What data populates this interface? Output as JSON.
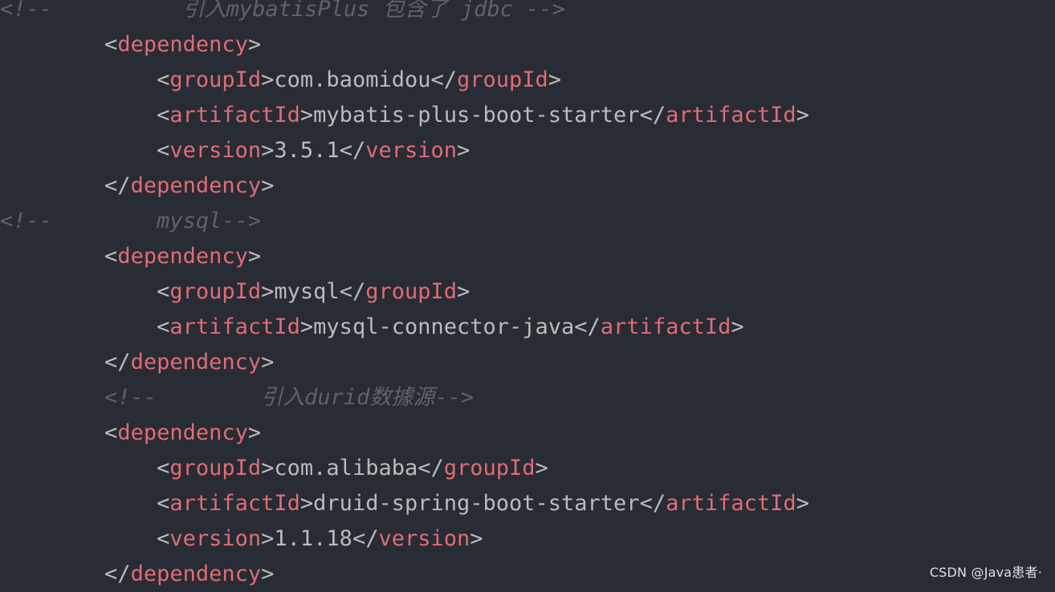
{
  "editor": {
    "lines": [
      {
        "kind": "comment",
        "indent": 0,
        "segments": [
          {
            "t": "<!--          引入mybatisPlus 包含了 jdbc -->",
            "c": "comment"
          }
        ]
      },
      {
        "kind": "tag",
        "indent": 8,
        "segments": [
          {
            "t": "<",
            "c": "punct"
          },
          {
            "t": "dependency",
            "c": "tag"
          },
          {
            "t": ">",
            "c": "punct"
          }
        ]
      },
      {
        "kind": "tag",
        "indent": 12,
        "segments": [
          {
            "t": "<",
            "c": "punct"
          },
          {
            "t": "groupId",
            "c": "tag"
          },
          {
            "t": ">",
            "c": "punct"
          },
          {
            "t": "com.baomidou",
            "c": "text"
          },
          {
            "t": "</",
            "c": "punct"
          },
          {
            "t": "groupId",
            "c": "tag"
          },
          {
            "t": ">",
            "c": "punct"
          }
        ]
      },
      {
        "kind": "tag",
        "indent": 12,
        "segments": [
          {
            "t": "<",
            "c": "punct"
          },
          {
            "t": "artifactId",
            "c": "tag"
          },
          {
            "t": ">",
            "c": "punct"
          },
          {
            "t": "mybatis-plus-boot-starter",
            "c": "text"
          },
          {
            "t": "</",
            "c": "punct"
          },
          {
            "t": "artifactId",
            "c": "tag"
          },
          {
            "t": ">",
            "c": "punct"
          }
        ]
      },
      {
        "kind": "tag",
        "indent": 12,
        "segments": [
          {
            "t": "<",
            "c": "punct"
          },
          {
            "t": "version",
            "c": "tag"
          },
          {
            "t": ">",
            "c": "punct"
          },
          {
            "t": "3.5.1",
            "c": "text"
          },
          {
            "t": "</",
            "c": "punct"
          },
          {
            "t": "version",
            "c": "tag"
          },
          {
            "t": ">",
            "c": "punct"
          }
        ]
      },
      {
        "kind": "tag",
        "indent": 8,
        "segments": [
          {
            "t": "</",
            "c": "punct"
          },
          {
            "t": "dependency",
            "c": "tag"
          },
          {
            "t": ">",
            "c": "punct"
          }
        ]
      },
      {
        "kind": "comment",
        "indent": 0,
        "segments": [
          {
            "t": "<!--        mysql-->",
            "c": "comment"
          }
        ]
      },
      {
        "kind": "tag",
        "indent": 8,
        "segments": [
          {
            "t": "<",
            "c": "punct"
          },
          {
            "t": "dependency",
            "c": "tag"
          },
          {
            "t": ">",
            "c": "punct"
          }
        ]
      },
      {
        "kind": "tag",
        "indent": 12,
        "segments": [
          {
            "t": "<",
            "c": "punct"
          },
          {
            "t": "groupId",
            "c": "tag"
          },
          {
            "t": ">",
            "c": "punct"
          },
          {
            "t": "mysql",
            "c": "text"
          },
          {
            "t": "</",
            "c": "punct"
          },
          {
            "t": "groupId",
            "c": "tag"
          },
          {
            "t": ">",
            "c": "punct"
          }
        ]
      },
      {
        "kind": "tag",
        "indent": 12,
        "segments": [
          {
            "t": "<",
            "c": "punct"
          },
          {
            "t": "artifactId",
            "c": "tag"
          },
          {
            "t": ">",
            "c": "punct"
          },
          {
            "t": "mysql-connector-java",
            "c": "text"
          },
          {
            "t": "</",
            "c": "punct"
          },
          {
            "t": "artifactId",
            "c": "tag"
          },
          {
            "t": ">",
            "c": "punct"
          }
        ]
      },
      {
        "kind": "tag",
        "indent": 8,
        "segments": [
          {
            "t": "</",
            "c": "punct"
          },
          {
            "t": "dependency",
            "c": "tag"
          },
          {
            "t": ">",
            "c": "punct"
          }
        ]
      },
      {
        "kind": "comment",
        "indent": 8,
        "segments": [
          {
            "t": "<!--        引入durid数據源-->",
            "c": "comment"
          }
        ]
      },
      {
        "kind": "tag",
        "indent": 8,
        "segments": [
          {
            "t": "<",
            "c": "punct"
          },
          {
            "t": "dependency",
            "c": "tag"
          },
          {
            "t": ">",
            "c": "punct"
          }
        ]
      },
      {
        "kind": "tag",
        "indent": 12,
        "segments": [
          {
            "t": "<",
            "c": "punct"
          },
          {
            "t": "groupId",
            "c": "tag"
          },
          {
            "t": ">",
            "c": "punct"
          },
          {
            "t": "com.alibaba",
            "c": "text"
          },
          {
            "t": "</",
            "c": "punct"
          },
          {
            "t": "groupId",
            "c": "tag"
          },
          {
            "t": ">",
            "c": "punct"
          }
        ]
      },
      {
        "kind": "tag",
        "indent": 12,
        "segments": [
          {
            "t": "<",
            "c": "punct"
          },
          {
            "t": "artifactId",
            "c": "tag"
          },
          {
            "t": ">",
            "c": "punct"
          },
          {
            "t": "druid-spring-boot-starter",
            "c": "text"
          },
          {
            "t": "</",
            "c": "punct"
          },
          {
            "t": "artifactId",
            "c": "tag"
          },
          {
            "t": ">",
            "c": "punct"
          }
        ]
      },
      {
        "kind": "tag",
        "indent": 12,
        "segments": [
          {
            "t": "<",
            "c": "punct"
          },
          {
            "t": "version",
            "c": "tag"
          },
          {
            "t": ">",
            "c": "punct"
          },
          {
            "t": "1.1.18",
            "c": "text"
          },
          {
            "t": "</",
            "c": "punct"
          },
          {
            "t": "version",
            "c": "tag"
          },
          {
            "t": ">",
            "c": "punct"
          }
        ]
      },
      {
        "kind": "tag",
        "indent": 8,
        "segments": [
          {
            "t": "</",
            "c": "punct"
          },
          {
            "t": "dependency",
            "c": "tag"
          },
          {
            "t": ">",
            "c": "punct"
          }
        ]
      }
    ]
  },
  "watermark": {
    "text": "CSDN @Java患者·"
  },
  "colors": {
    "background": "#282c34",
    "tag": "#e06c75",
    "text": "#bbbbbb",
    "comment": "#5c6370"
  }
}
